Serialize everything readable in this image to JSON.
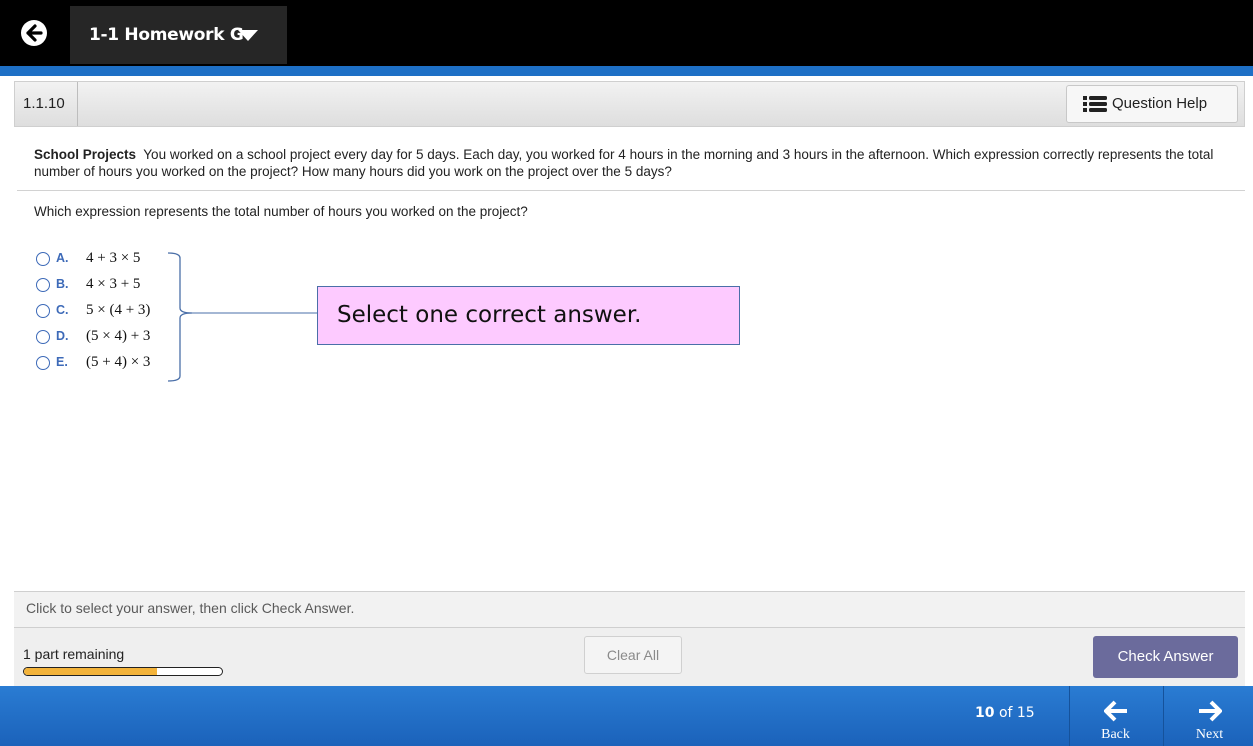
{
  "header": {
    "assignment_title": "1-1 Homework G",
    "back_icon": "back-arrow-circle-icon",
    "dropdown_icon": "caret-down-icon"
  },
  "question_bar": {
    "question_number": "1.1.10",
    "help_label": "Question Help",
    "help_icon": "list-icon"
  },
  "problem": {
    "title": "School Projects",
    "text": "You worked on a school project every day for 5 days. Each day, you worked for 4 hours in the morning and 3 hours in the afternoon. Which expression correctly represents the total number of hours you worked on the project? How many hours did you work on the project over the 5 days?",
    "prompt": "Which expression represents the total number of hours you worked on the project?"
  },
  "options": [
    {
      "letter": "A.",
      "expression": "4 + 3 × 5"
    },
    {
      "letter": "B.",
      "expression": "4 × 3 + 5"
    },
    {
      "letter": "C.",
      "expression": "5 × (4 + 3)"
    },
    {
      "letter": "D.",
      "expression": "(5 × 4) + 3"
    },
    {
      "letter": "E.",
      "expression": "(5 + 4) × 3"
    }
  ],
  "callout": {
    "text": "Select one correct answer.",
    "color": "#fdcaff"
  },
  "footer": {
    "hint": "Click to select your answer, then click Check Answer.",
    "remaining": "1 part remaining",
    "progress_fraction": 0.67,
    "clear_label": "Clear All",
    "check_label": "Check Answer"
  },
  "nav": {
    "current": "10",
    "of_label": "of",
    "total": "15",
    "back_label": "Back",
    "next_label": "Next"
  },
  "colors": {
    "accent_blue": "#1e70c6",
    "option_blue": "#3d6ab8",
    "check_button": "#6b6b9c",
    "progress": "#f3b33a"
  }
}
